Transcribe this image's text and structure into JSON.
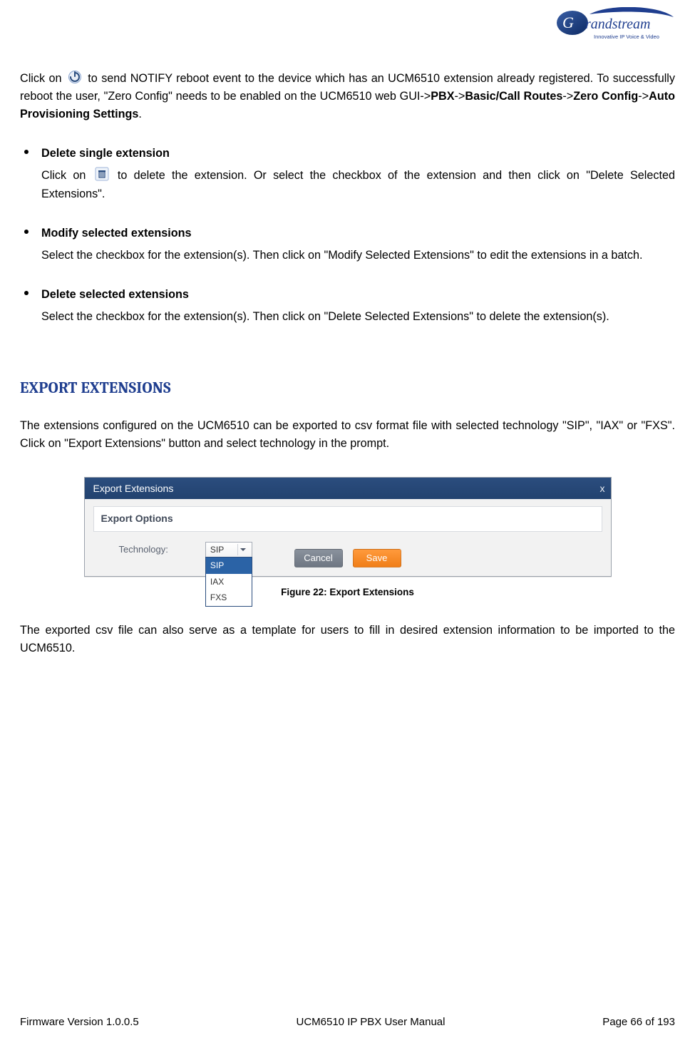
{
  "header": {
    "brand_name": "Grandstream",
    "brand_tagline": "Innovative IP Voice & Video"
  },
  "reboot": {
    "pre": "Click on",
    "post1": "to send NOTIFY reboot event to the device which has an UCM6510 extension already registered. To successfully reboot the user, \"Zero Config\" needs to be enabled on the UCM6510 web GUI->",
    "pbx": "PBX",
    "arrow1": "->",
    "basic": "Basic/Call Routes",
    "arrow2": "->",
    "zero": "Zero Config",
    "arrow3": "->",
    "auto": "Auto Provisioning Settings",
    "period": "."
  },
  "bullets": {
    "delete_single": {
      "title": "Delete single extension",
      "pre": "Click on",
      "post": "to delete the extension. Or select the checkbox of the extension and then click on \"Delete Selected Extensions\"."
    },
    "modify_selected": {
      "title": "Modify selected extensions",
      "body": "Select the checkbox for the extension(s). Then click on \"Modify Selected Extensions\" to edit the extensions in a batch."
    },
    "delete_selected": {
      "title": "Delete selected extensions",
      "body": "Select the checkbox for the extension(s). Then click on \"Delete Selected Extensions\" to delete the extension(s)."
    }
  },
  "section_heading": "EXPORT EXTENSIONS",
  "export_intro": "The extensions configured on the UCM6510 can be exported to csv format file with selected technology \"SIP\", \"IAX\" or \"FXS\". Click on \"Export Extensions\" button and select technology in the prompt.",
  "dialog": {
    "title": "Export Extensions",
    "close_glyph": "x",
    "subtitle": "Export Options",
    "form": {
      "technology_label": "Technology:",
      "selected": "SIP",
      "options": [
        "SIP",
        "IAX",
        "FXS"
      ]
    },
    "buttons": {
      "cancel": "Cancel",
      "save": "Save"
    }
  },
  "figure_caption": "Figure 22: Export Extensions",
  "after_figure": "The exported csv file can also serve as a template for users to fill in desired extension information to be imported to the UCM6510.",
  "footer": {
    "left": "Firmware Version 1.0.0.5",
    "center": "UCM6510 IP PBX User Manual",
    "right": "Page 66 of 193"
  },
  "icons": {
    "reboot": "reboot-icon",
    "trash": "trash-icon"
  },
  "colors": {
    "heading": "#1f3e8f",
    "dialog_header": "#2b4d7e",
    "save_btn": "#f07e18"
  }
}
